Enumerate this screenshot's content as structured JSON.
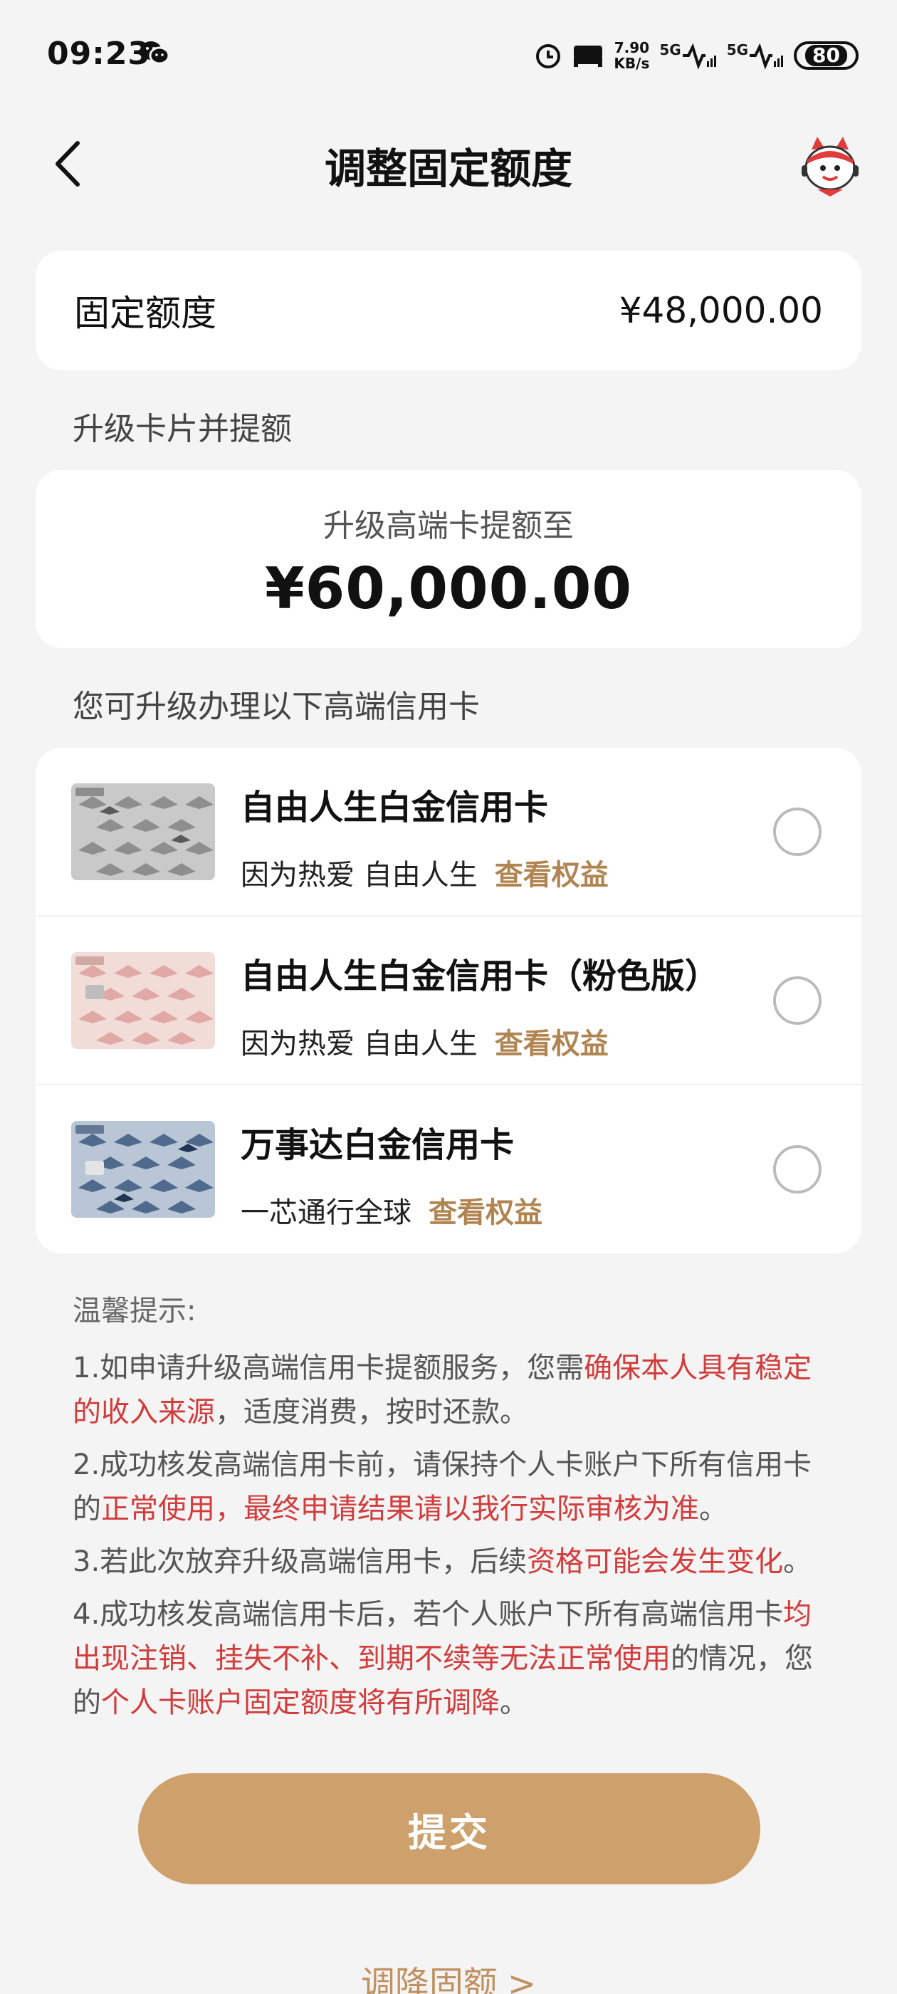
{
  "status_bar": {
    "time": "09:23",
    "net_speed_value": "7.90",
    "net_speed_unit": "KB/s",
    "signal1": "5G",
    "signal2": "5G",
    "battery": "80"
  },
  "nav": {
    "title": "调整固定额度"
  },
  "fixed_limit": {
    "label": "固定额度",
    "amount": "¥48,000.00"
  },
  "upgrade_section": {
    "title": "升级卡片并提额",
    "subtitle": "升级高端卡提额至",
    "amount": "¥60,000.00"
  },
  "cards_section": {
    "title": "您可升级办理以下高端信用卡",
    "cards": [
      {
        "name": "自由人生白金信用卡",
        "desc": "因为热爱 自由人生",
        "link": "查看权益",
        "selected": false,
        "image": "gray-crane-card"
      },
      {
        "name": "自由人生白金信用卡（粉色版）",
        "desc": "因为热爱 自由人生",
        "link": "查看权益",
        "selected": false,
        "image": "pink-crane-card"
      },
      {
        "name": "万事达白金信用卡",
        "desc": "一芯通行全球",
        "link": "查看权益",
        "selected": false,
        "image": "blue-crane-card"
      }
    ]
  },
  "tips": {
    "title": "温馨提示:",
    "items": [
      {
        "parts": [
          {
            "t": "1.如申请升级高端信用卡提额服务，您需",
            "hl": false
          },
          {
            "t": "确保本人具有稳定的收入来源",
            "hl": true
          },
          {
            "t": "，适度消费，按时还款。",
            "hl": false
          }
        ]
      },
      {
        "parts": [
          {
            "t": "2.成功核发高端信用卡前，请保持个人卡账户下所有信用卡的",
            "hl": false
          },
          {
            "t": "正常使用，最终申请结果请以我行实际审核为准",
            "hl": true
          },
          {
            "t": "。",
            "hl": false
          }
        ]
      },
      {
        "parts": [
          {
            "t": "3.若此次放弃升级高端信用卡，后续",
            "hl": false
          },
          {
            "t": "资格可能会发生变化",
            "hl": true
          },
          {
            "t": "。",
            "hl": false
          }
        ]
      },
      {
        "parts": [
          {
            "t": "4.成功核发高端信用卡后，若个人账户下所有高端信用卡",
            "hl": false
          },
          {
            "t": "均出现注销、挂失不补、到期不续等无法正常使用",
            "hl": true
          },
          {
            "t": "的情况，您的",
            "hl": false
          },
          {
            "t": "个人卡账户固定额度将有所调降",
            "hl": true
          },
          {
            "t": "。",
            "hl": false
          }
        ]
      }
    ]
  },
  "submit": {
    "label": "提交"
  },
  "lower_link": {
    "label": "调降固额",
    "chevron": ">"
  },
  "colors": {
    "accent": "#cda06c",
    "link": "#b08552",
    "highlight": "#d23c3c",
    "background": "#f4f4f4"
  }
}
